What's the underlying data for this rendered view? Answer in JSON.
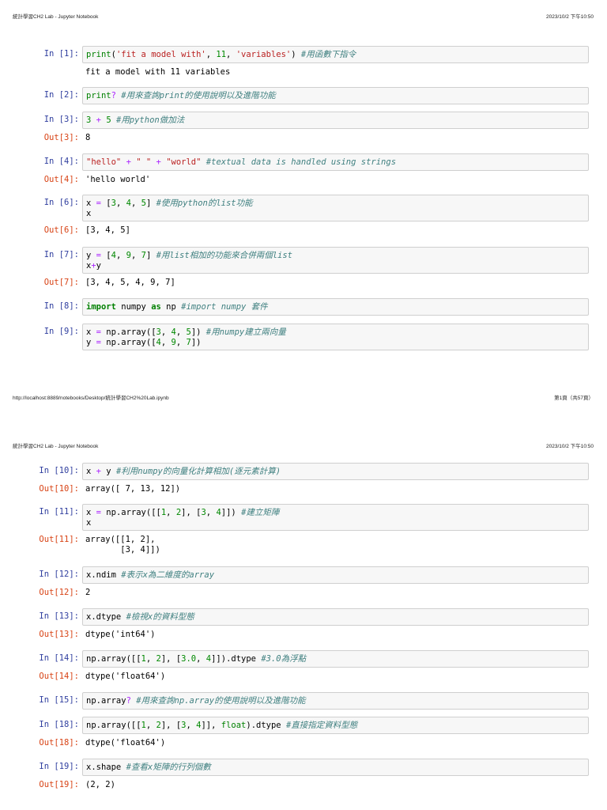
{
  "pages": [
    {
      "header_title": "統計學習CH2 Lab - Jupyter Notebook",
      "header_datetime": "2023/10/2 下午10:50",
      "footer_url": "http://localhost:8889/notebooks/Desktop/統計學習CH2%20Lab.ipynb",
      "footer_page": "第1頁（共57頁）"
    },
    {
      "header_title": "統計學習CH2 Lab - Jupyter Notebook",
      "header_datetime": "2023/10/2 下午10:50"
    }
  ],
  "cells": [
    {
      "in": "In [1]:",
      "code": [
        [
          [
            "print",
            "b"
          ],
          [
            "(",
            "p"
          ],
          [
            "'fit a model with'",
            "s"
          ],
          [
            ", ",
            "p"
          ],
          [
            "11",
            "n"
          ],
          [
            ", ",
            "p"
          ],
          [
            "'variables'",
            "s"
          ],
          [
            ") ",
            "p"
          ],
          [
            "#用函數下指令",
            "c"
          ]
        ]
      ],
      "out_prompt": "",
      "out": [
        "fit a model with 11 variables"
      ]
    },
    {
      "in": "In [2]:",
      "code": [
        [
          [
            "print",
            "b"
          ],
          [
            "?",
            "o"
          ],
          [
            " ",
            "p"
          ],
          [
            "#用來查詢print的使用說明以及進階功能",
            "c"
          ]
        ]
      ],
      "out_prompt": null,
      "out": []
    },
    {
      "in": "In [3]:",
      "code": [
        [
          [
            "3",
            "n"
          ],
          [
            " ",
            "p"
          ],
          [
            "+",
            "o"
          ],
          [
            " ",
            "p"
          ],
          [
            "5",
            "n"
          ],
          [
            " ",
            "p"
          ],
          [
            "#用python做加法",
            "c"
          ]
        ]
      ],
      "out_prompt": "Out[3]:",
      "out": [
        "8"
      ]
    },
    {
      "in": "In [4]:",
      "code": [
        [
          [
            "\"hello\"",
            "s"
          ],
          [
            " ",
            "p"
          ],
          [
            "+",
            "o"
          ],
          [
            " ",
            "p"
          ],
          [
            "\" \"",
            "s"
          ],
          [
            " ",
            "p"
          ],
          [
            "+",
            "o"
          ],
          [
            " ",
            "p"
          ],
          [
            "\"world\"",
            "s"
          ],
          [
            " ",
            "p"
          ],
          [
            "#textual data is handled using strings",
            "c"
          ]
        ]
      ],
      "out_prompt": "Out[4]:",
      "out": [
        "'hello world'"
      ]
    },
    {
      "in": "In [6]:",
      "code": [
        [
          [
            "x ",
            "p"
          ],
          [
            "=",
            "o"
          ],
          [
            " [",
            "p"
          ],
          [
            "3",
            "n"
          ],
          [
            ", ",
            "p"
          ],
          [
            "4",
            "n"
          ],
          [
            ", ",
            "p"
          ],
          [
            "5",
            "n"
          ],
          [
            "] ",
            "p"
          ],
          [
            "#使用python的list功能",
            "c"
          ]
        ],
        [
          [
            "x",
            "p"
          ]
        ]
      ],
      "out_prompt": "Out[6]:",
      "out": [
        "[3, 4, 5]"
      ]
    },
    {
      "in": "In [7]:",
      "code": [
        [
          [
            "y ",
            "p"
          ],
          [
            "=",
            "o"
          ],
          [
            " [",
            "p"
          ],
          [
            "4",
            "n"
          ],
          [
            ", ",
            "p"
          ],
          [
            "9",
            "n"
          ],
          [
            ", ",
            "p"
          ],
          [
            "7",
            "n"
          ],
          [
            "] ",
            "p"
          ],
          [
            "#用list相加的功能來合併兩個list",
            "c"
          ]
        ],
        [
          [
            "x",
            "p"
          ],
          [
            "+",
            "o"
          ],
          [
            "y",
            "p"
          ]
        ]
      ],
      "out_prompt": "Out[7]:",
      "out": [
        "[3, 4, 5, 4, 9, 7]"
      ]
    },
    {
      "in": "In [8]:",
      "code": [
        [
          [
            "import",
            "k"
          ],
          [
            " numpy ",
            "p"
          ],
          [
            "as",
            "k"
          ],
          [
            " np ",
            "p"
          ],
          [
            "#import numpy 套件",
            "c"
          ]
        ]
      ],
      "out_prompt": null,
      "out": []
    },
    {
      "in": "In [9]:",
      "code": [
        [
          [
            "x ",
            "p"
          ],
          [
            "=",
            "o"
          ],
          [
            " np.array([",
            "p"
          ],
          [
            "3",
            "n"
          ],
          [
            ", ",
            "p"
          ],
          [
            "4",
            "n"
          ],
          [
            ", ",
            "p"
          ],
          [
            "5",
            "n"
          ],
          [
            "]) ",
            "p"
          ],
          [
            "#用numpy建立兩向量",
            "c"
          ]
        ],
        [
          [
            "y ",
            "p"
          ],
          [
            "=",
            "o"
          ],
          [
            " np.array([",
            "p"
          ],
          [
            "4",
            "n"
          ],
          [
            ", ",
            "p"
          ],
          [
            "9",
            "n"
          ],
          [
            ", ",
            "p"
          ],
          [
            "7",
            "n"
          ],
          [
            "])",
            "p"
          ]
        ]
      ],
      "out_prompt": null,
      "out": []
    },
    {
      "in": "In [10]:",
      "code": [
        [
          [
            "x ",
            "p"
          ],
          [
            "+",
            "o"
          ],
          [
            " y ",
            "p"
          ],
          [
            "#利用numpy的向量化計算相加(逐元素計算)",
            "c"
          ]
        ]
      ],
      "out_prompt": "Out[10]:",
      "out": [
        "array([ 7, 13, 12])"
      ]
    },
    {
      "in": "In [11]:",
      "code": [
        [
          [
            "x ",
            "p"
          ],
          [
            "=",
            "o"
          ],
          [
            " np.array([[",
            "p"
          ],
          [
            "1",
            "n"
          ],
          [
            ", ",
            "p"
          ],
          [
            "2",
            "n"
          ],
          [
            "], [",
            "p"
          ],
          [
            "3",
            "n"
          ],
          [
            ", ",
            "p"
          ],
          [
            "4",
            "n"
          ],
          [
            "]]) ",
            "p"
          ],
          [
            "#建立矩陣",
            "c"
          ]
        ],
        [
          [
            "x",
            "p"
          ]
        ]
      ],
      "out_prompt": "Out[11]:",
      "out": [
        "array([[1, 2],",
        "       [3, 4]])"
      ]
    },
    {
      "in": "In [12]:",
      "code": [
        [
          [
            "x.ndim ",
            "p"
          ],
          [
            "#表示x為二維度的array",
            "c"
          ]
        ]
      ],
      "out_prompt": "Out[12]:",
      "out": [
        "2"
      ]
    },
    {
      "in": "In [13]:",
      "code": [
        [
          [
            "x.dtype ",
            "p"
          ],
          [
            "#檢視x的資料型態",
            "c"
          ]
        ]
      ],
      "out_prompt": "Out[13]:",
      "out": [
        "dtype('int64')"
      ]
    },
    {
      "in": "In [14]:",
      "code": [
        [
          [
            "np.array([[",
            "p"
          ],
          [
            "1",
            "n"
          ],
          [
            ", ",
            "p"
          ],
          [
            "2",
            "n"
          ],
          [
            "], [",
            "p"
          ],
          [
            "3.0",
            "n"
          ],
          [
            ", ",
            "p"
          ],
          [
            "4",
            "n"
          ],
          [
            "]]).dtype ",
            "p"
          ],
          [
            "#3.0為浮點",
            "c"
          ]
        ]
      ],
      "out_prompt": "Out[14]:",
      "out": [
        "dtype('float64')"
      ]
    },
    {
      "in": "In [15]:",
      "code": [
        [
          [
            "np.array",
            "p"
          ],
          [
            "?",
            "o"
          ],
          [
            " ",
            "p"
          ],
          [
            "#用來查詢np.array的使用說明以及進階功能",
            "c"
          ]
        ]
      ],
      "out_prompt": null,
      "out": []
    },
    {
      "in": "In [18]:",
      "code": [
        [
          [
            "np.array([[",
            "p"
          ],
          [
            "1",
            "n"
          ],
          [
            ", ",
            "p"
          ],
          [
            "2",
            "n"
          ],
          [
            "], [",
            "p"
          ],
          [
            "3",
            "n"
          ],
          [
            ", ",
            "p"
          ],
          [
            "4",
            "n"
          ],
          [
            "]], ",
            "p"
          ],
          [
            "float",
            "b"
          ],
          [
            ").dtype ",
            "p"
          ],
          [
            "#直接指定資料型態",
            "c"
          ]
        ]
      ],
      "out_prompt": "Out[18]:",
      "out": [
        "dtype('float64')"
      ]
    },
    {
      "in": "In [19]:",
      "code": [
        [
          [
            "x.shape ",
            "p"
          ],
          [
            "#查看x矩陣的行列個數",
            "c"
          ]
        ]
      ],
      "out_prompt": "Out[19]:",
      "out": [
        "(2, 2)"
      ]
    }
  ]
}
